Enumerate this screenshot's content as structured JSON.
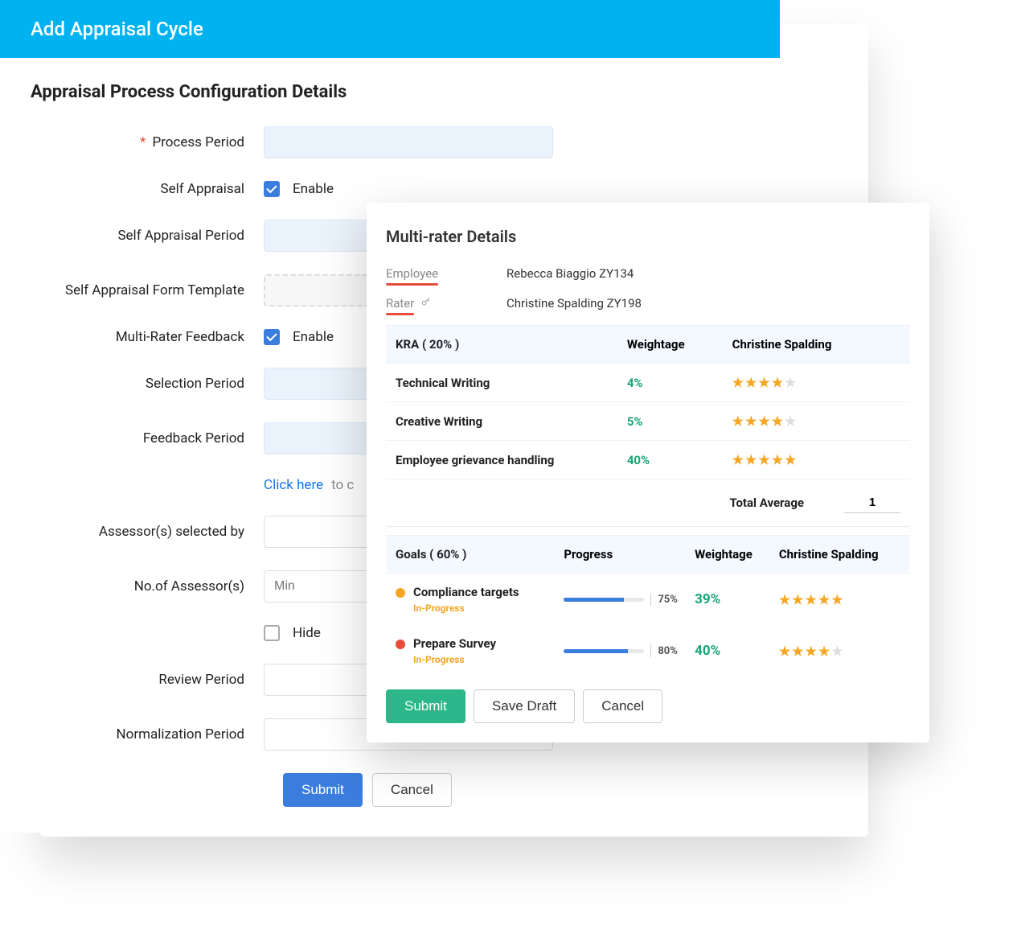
{
  "header": {
    "title": "Add Appraisal Cycle"
  },
  "section": {
    "title": "Appraisal Process Configuration Details"
  },
  "form": {
    "process_period": {
      "label": "Process Period",
      "required_mark": "*"
    },
    "self_appraisal": {
      "label": "Self Appraisal",
      "enable": "Enable",
      "checked": true
    },
    "self_appraisal_period": {
      "label": "Self Appraisal Period"
    },
    "self_form_template": {
      "label": "Self Appraisal Form Template"
    },
    "multi_rater": {
      "label": "Multi-Rater Feedback",
      "enable": "Enable",
      "checked": true
    },
    "selection_period": {
      "label": "Selection Period"
    },
    "feedback_period": {
      "label": "Feedback Period"
    },
    "click_link": {
      "text": "Click here",
      "rest": " to c"
    },
    "assessor_selected_by": {
      "label": "Assessor(s) selected by"
    },
    "no_of_assessors": {
      "label": "No.of Assessor(s)",
      "placeholder": "Min"
    },
    "hide": {
      "label": "Hide",
      "checked": false
    },
    "review_period": {
      "label": "Review Period"
    },
    "normalization_period": {
      "label": "Normalization Period"
    },
    "actions": {
      "submit": "Submit",
      "cancel": "Cancel"
    }
  },
  "overlay": {
    "title": "Multi-rater Details",
    "employee": {
      "key": "Employee",
      "value": "Rebecca Biaggio ZY134"
    },
    "rater": {
      "key": "Rater",
      "icon": "🔑",
      "value": "Christine Spalding ZY198"
    },
    "kra": {
      "header_label": "KRA ( 20% )",
      "weight_header": "Weightage",
      "rater_header": "Christine Spalding",
      "rows": [
        {
          "name": "Technical Writing",
          "weight": "4%",
          "stars": 4
        },
        {
          "name": "Creative Writing",
          "weight": "5%",
          "stars": 4
        },
        {
          "name": "Employee grievance handling",
          "weight": "40%",
          "stars": 5
        }
      ],
      "total_label": "Total Average",
      "total_value": "1"
    },
    "goals": {
      "header_label": "Goals ( 60% )",
      "progress_header": "Progress",
      "weight_header": "Weightage",
      "rater_header": "Christine Spalding",
      "rows": [
        {
          "dot": "amber",
          "name": "Compliance targets",
          "status": "In-Progress",
          "progress": 75,
          "progress_label": "75%",
          "weight": "39%",
          "stars": 5
        },
        {
          "dot": "red",
          "name": "Prepare Survey",
          "status": "In-Progress",
          "progress": 80,
          "progress_label": "80%",
          "weight": "40%",
          "stars": 4
        }
      ]
    },
    "actions": {
      "submit": "Submit",
      "save_draft": "Save Draft",
      "cancel": "Cancel"
    }
  }
}
